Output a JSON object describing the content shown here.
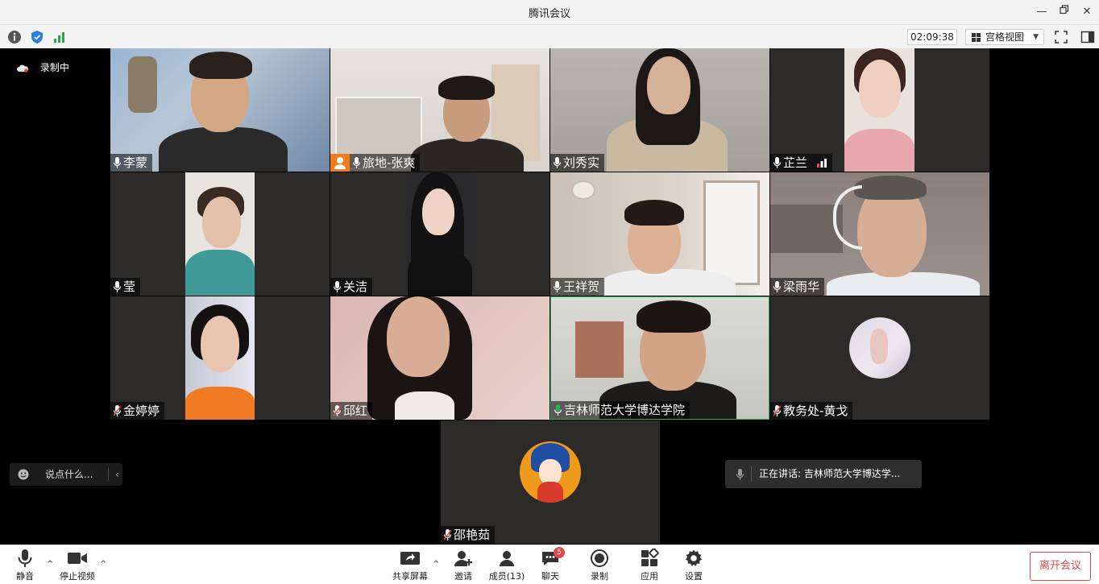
{
  "window": {
    "title": "腾讯会议"
  },
  "topbar": {
    "timer": "02:09:38",
    "view_mode": "宫格视图"
  },
  "recording": {
    "label": "录制中"
  },
  "participants": [
    {
      "name": "李蒙",
      "mic": "on"
    },
    {
      "name": "旅地-张爽",
      "mic": "on"
    },
    {
      "name": "刘秀实",
      "mic": "on"
    },
    {
      "name": "芷兰",
      "mic": "on"
    },
    {
      "name": "莹",
      "mic": "on"
    },
    {
      "name": "关洁",
      "mic": "on"
    },
    {
      "name": "王祥贺",
      "mic": "on"
    },
    {
      "name": "梁雨华",
      "mic": "on"
    },
    {
      "name": "金婷婷",
      "mic": "muted"
    },
    {
      "name": "邱红",
      "mic": "muted"
    },
    {
      "name": "吉林师范大学博达学院",
      "mic": "speaking"
    },
    {
      "name": "教务处-黄戈",
      "mic": "muted"
    },
    {
      "name": "邵艳茹",
      "mic": "muted"
    }
  ],
  "chat_bubble": {
    "placeholder": "说点什么..."
  },
  "speaking_indicator": {
    "text": "正在讲话: 吉林师范大学博达学..."
  },
  "toolbar": {
    "mute": "静音",
    "stop_video": "停止视频",
    "share_screen": "共享屏幕",
    "invite": "邀请",
    "members": "成员(13)",
    "chat": "聊天",
    "chat_badge": "5",
    "record": "录制",
    "apps": "应用",
    "settings": "设置",
    "leave": "离开会议"
  },
  "colors": {
    "speaking_green": "#1fb35e",
    "leave_red": "#e04a4a",
    "muted_red": "#e2494a"
  }
}
